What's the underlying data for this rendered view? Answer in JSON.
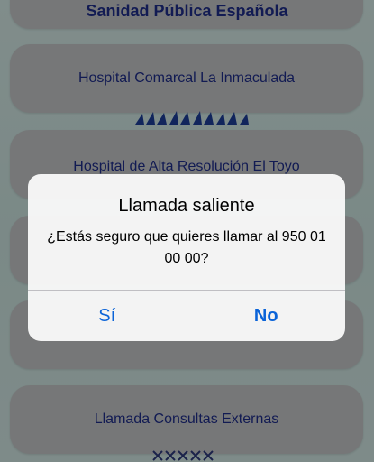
{
  "header": {
    "title": "Sanidad Pública Española"
  },
  "menu": {
    "items": [
      {
        "label": ""
      },
      {
        "label": "Hospital Comarcal La Inmaculada"
      },
      {
        "label": "Hospital de Alta Resolución El Toyo"
      },
      {
        "label": ""
      },
      {
        "label": ""
      },
      {
        "label": "Llamada Consultas Externas"
      }
    ]
  },
  "dialog": {
    "title": "Llamada saliente",
    "message": "¿Estás seguro que quieres llamar al 950 01 00 00?",
    "buttons": {
      "yes": "Sí",
      "no": "No"
    }
  },
  "colors": {
    "accent": "#1f2d8a",
    "button_bg": "#c5c7c9",
    "ios_blue": "#0a63d8"
  }
}
